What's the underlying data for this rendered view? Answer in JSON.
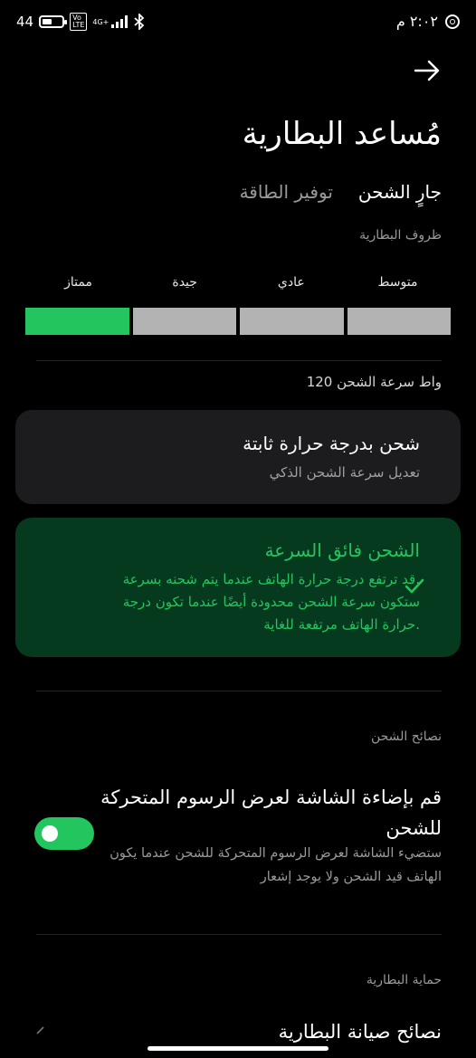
{
  "status_bar": {
    "battery_text": "44",
    "network": "4G+",
    "time": "٢:٠٢ م"
  },
  "header": {
    "title": "مُساعد البطارية"
  },
  "tabs": [
    {
      "label": "جارٍ الشحن",
      "active": true
    },
    {
      "label": "توفير الطاقة",
      "active": false
    }
  ],
  "battery_conditions": {
    "label": "ظروف البطارية",
    "levels": [
      "متوسط",
      "عادي",
      "جيدة",
      "ممتاز"
    ],
    "active_level": "ممتاز"
  },
  "charging_speed": {
    "text": "120 واط سرعة الشحن"
  },
  "cards": {
    "constant_temp": {
      "title": "شحن بدرجة حرارة ثابتة",
      "subtitle": "تعديل سرعة الشحن الذكي"
    },
    "super_fast": {
      "title": "الشحن فائق السرعة",
      "description_lines": [
        "قد ترتفع درجة حرارة الهاتف عندما يتم شحنه بسرعة.",
        "ستكون سرعة الشحن محدودة أيضًا عندما تكون درجة",
        "حرارة الهاتف مرتفعة للغاية."
      ],
      "selected": true
    }
  },
  "charging_tips": {
    "label": "نصائح الشحن",
    "item_title": "قم بإضاءة الشاشة لعرض الرسوم المتحركة للشحن",
    "item_description": "ستضيء الشاشة لعرض الرسوم المتحركة للشحن عندما يكون الهاتف قيد الشحن ولا يوجد إشعار",
    "toggle_on": true
  },
  "battery_protection": {
    "label": "حماية البطارية",
    "item_title": "نصائح صيانة البطارية"
  },
  "colors": {
    "accent": "#22c55e",
    "accent_card_bg": "#063a1f",
    "card_bg": "#1c1c1e",
    "segment_inactive": "#b3b3b3"
  }
}
